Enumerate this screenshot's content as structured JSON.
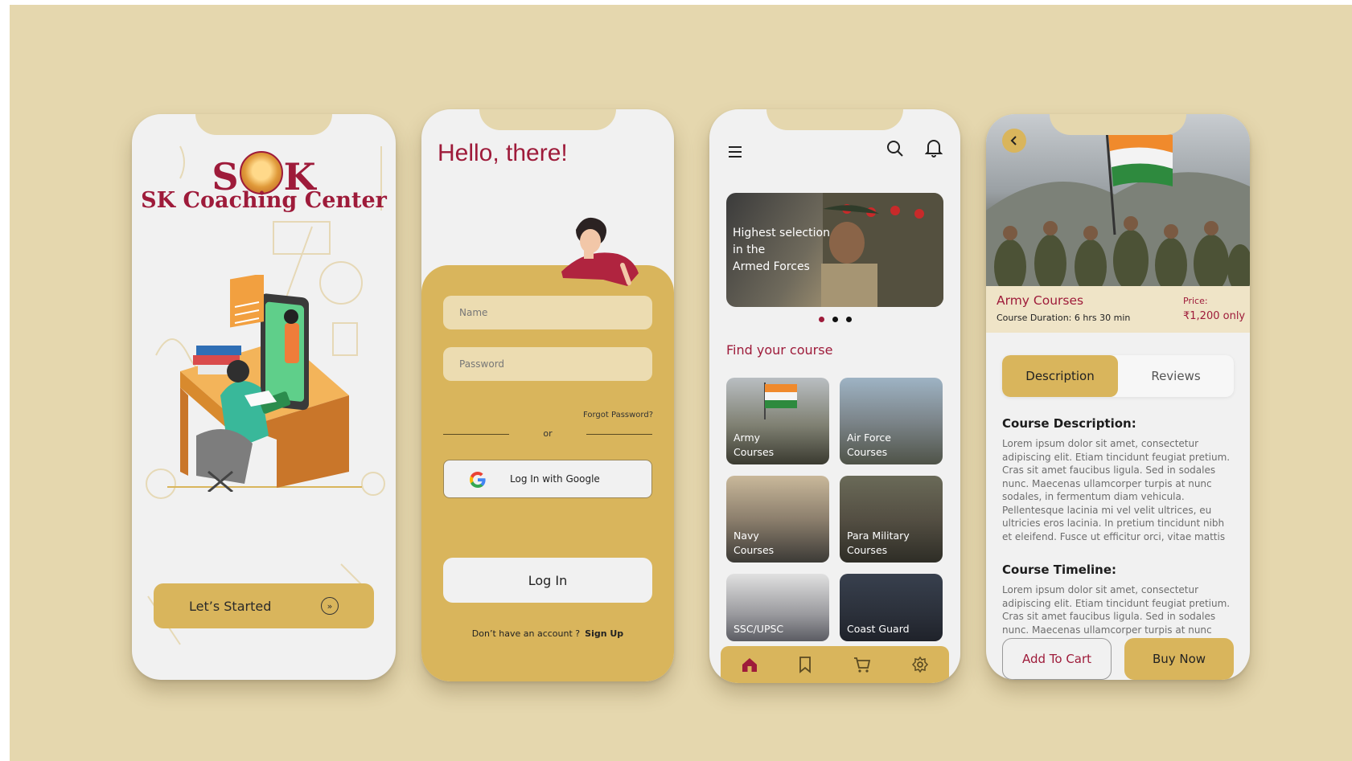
{
  "splash": {
    "logo_left": "S",
    "logo_right": "K",
    "subtitle": "SK Coaching Center",
    "start_label": "Let’s Started"
  },
  "login": {
    "greeting": "Hello, there!",
    "name_placeholder": "Name",
    "password_placeholder": "Password",
    "forgot": "Forgot Password?",
    "or": "or",
    "google_label": "Log In with Google",
    "login_label": "Log In",
    "no_account": "Don’t have an account ?",
    "signup": "Sign Up"
  },
  "home": {
    "banner_lines": [
      "Highest selection",
      "in the",
      "Armed Forces"
    ],
    "find_title": "Find your course",
    "courses": [
      {
        "line1": "Army",
        "line2": "Courses"
      },
      {
        "line1": "Air Force",
        "line2": "Courses"
      },
      {
        "line1": "Navy",
        "line2": "Courses"
      },
      {
        "line1": "Para Military",
        "line2": "Courses"
      },
      {
        "line1": "SSC/UPSC",
        "line2": ""
      },
      {
        "line1": "Coast Guard",
        "line2": ""
      }
    ]
  },
  "detail": {
    "title": "Army Courses",
    "duration_label": "Course Duration:",
    "duration_value": "6 hrs 30 min",
    "price_label": "Price:",
    "price_value": "₹1,200 only",
    "tab_description": "Description",
    "tab_reviews": "Reviews",
    "desc_title": "Course Description:",
    "desc_body": "Lorem ipsum dolor sit amet, consectetur adipiscing elit. Etiam tincidunt feugiat pretium. Cras sit amet faucibus ligula. Sed in sodales nunc. Maecenas ullamcorper turpis at nunc sodales, in fermentum diam vehicula. Pellentesque lacinia mi vel velit ultrices, eu ultricies eros lacinia. In pretium tincidunt nibh et eleifend. Fusce ut efficitur orci, vitae mattis ligula.",
    "timeline_title": "Course Timeline:",
    "timeline_body": "Lorem ipsum dolor sit amet, consectetur adipiscing elit. Etiam tincidunt feugiat pretium. Cras sit amet faucibus ligula. Sed in sodales nunc. Maecenas ullamcorper turpis at nunc sodales, in fermentum",
    "add_to_cart": "Add To Cart",
    "buy_now": "Buy Now"
  },
  "colors": {
    "background": "#e5d7ae",
    "accent": "#d9b55c",
    "brand": "#9e1b3a",
    "phone": "#f1f1f1"
  },
  "icons": {
    "menu": "hamburger-icon",
    "search": "search-icon",
    "notification": "bell-icon",
    "home": "home-icon",
    "bookmark": "bookmark-icon",
    "cart": "cart-icon",
    "settings": "gear-icon",
    "back": "chevron-left-icon",
    "forward": "double-chevron-right-icon",
    "google": "google-icon"
  }
}
